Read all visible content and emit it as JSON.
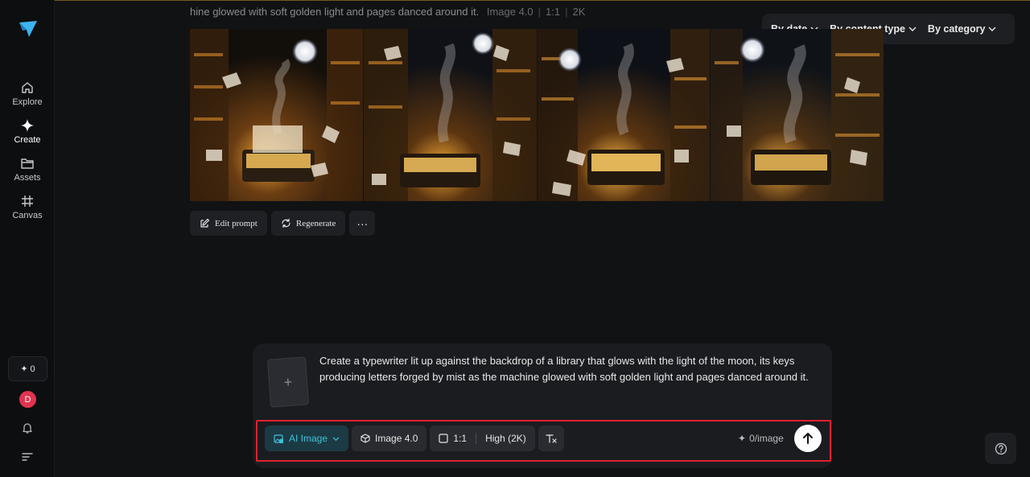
{
  "header": {
    "prompt_excerpt": "hine glowed with soft golden light and pages danced around it.",
    "model": "Image 4.0",
    "ratio": "1:1",
    "resolution": "2K"
  },
  "sidebar": {
    "items": [
      {
        "label": "Explore",
        "icon": "home-icon"
      },
      {
        "label": "Create",
        "icon": "sparkle-icon"
      },
      {
        "label": "Assets",
        "icon": "folder-icon"
      },
      {
        "label": "Canvas",
        "icon": "canvas-icon"
      }
    ],
    "credits": "0",
    "avatar_initial": "D"
  },
  "filters": {
    "by_date": "By date",
    "by_content_type": "By content type",
    "by_category": "By category"
  },
  "actions": {
    "edit_prompt": "Edit prompt",
    "regenerate": "Regenerate",
    "more": "···"
  },
  "composer": {
    "prompt": "Create a typewriter lit up against the backdrop of a library that glows with the light of the moon, its keys producing letters forged by mist as the machine glowed with soft golden light and pages danced around it.",
    "upload_symbol": "+"
  },
  "toolbar": {
    "mode": "AI Image",
    "model": "Image 4.0",
    "ratio": "1:1",
    "quality": "High (2K)",
    "cost": "0/image"
  },
  "colors": {
    "accent": "#3fc1d9",
    "highlight": "#e0202e",
    "avatar": "#e0344f"
  }
}
